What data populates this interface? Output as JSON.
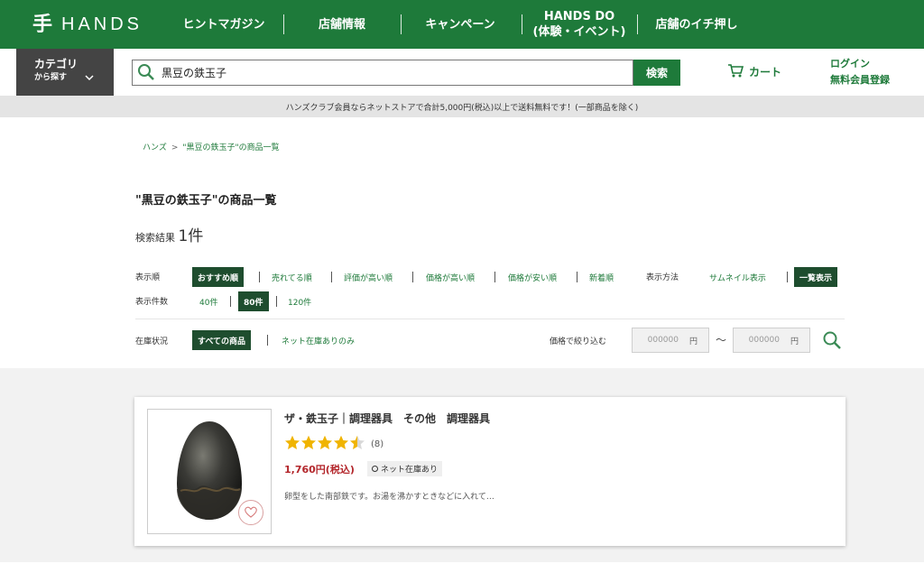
{
  "header": {
    "logo_mark": "手",
    "logo_text": "HANDS",
    "nav": [
      {
        "line1": "ヒントマガジン",
        "line2": ""
      },
      {
        "line1": "店舗情報",
        "line2": ""
      },
      {
        "line1": "キャンペーン",
        "line2": ""
      },
      {
        "line1": "HANDS DO",
        "line2": "(体験・イベント)"
      },
      {
        "line1": "店舗のイチ押し",
        "line2": ""
      }
    ]
  },
  "search": {
    "category_line1": "カテゴリ",
    "category_line2": "から探す",
    "query": "黒豆の鉄玉子",
    "button_label": "検索",
    "cart_label": "カート",
    "login_label": "ログイン",
    "register_label": "無料会員登録"
  },
  "notice": "ハンズクラブ会員ならネットストアで合計5,000円(税込)以上で送料無料です！(一部商品を除く)",
  "breadcrumb": {
    "home": "ハンズ",
    "sep": ">",
    "current": "\"黒豆の鉄玉子\"の商品一覧"
  },
  "page_title": "\"黒豆の鉄玉子\"の商品一覧",
  "result": {
    "label": "検索結果",
    "count": "1件"
  },
  "sort": {
    "label": "表示順",
    "options": [
      "おすすめ順",
      "売れてる順",
      "評価が高い順",
      "価格が高い順",
      "価格が安い順",
      "新着順"
    ],
    "active": "おすすめ順"
  },
  "display": {
    "label": "表示方法",
    "options": [
      "サムネイル表示",
      "一覧表示"
    ],
    "active": "一覧表示"
  },
  "per_page": {
    "label": "表示件数",
    "options": [
      "40件",
      "80件",
      "120件"
    ],
    "active": "80件"
  },
  "stock_filter": {
    "label": "在庫状況",
    "options": [
      "すべての商品",
      "ネット在庫ありのみ"
    ],
    "active": "すべての商品"
  },
  "price_filter": {
    "label": "価格で絞り込む",
    "min_placeholder": "000000",
    "max_placeholder": "000000",
    "unit": "円",
    "tilde": "〜"
  },
  "products": [
    {
      "name": "ザ・鉄玉子｜調理器具　その他　調理器具",
      "rating": 4.5,
      "review_count": "(8)",
      "price": "1,760円(税込)",
      "stock": "ネット在庫あり",
      "description": "卵型をした南部鉄です。お湯を沸かすときなどに入れて…"
    }
  ],
  "colors": {
    "brand": "#1e7a3a",
    "active_tab": "#1e4d2e",
    "price": "#b3262b",
    "star": "#f0b400"
  }
}
